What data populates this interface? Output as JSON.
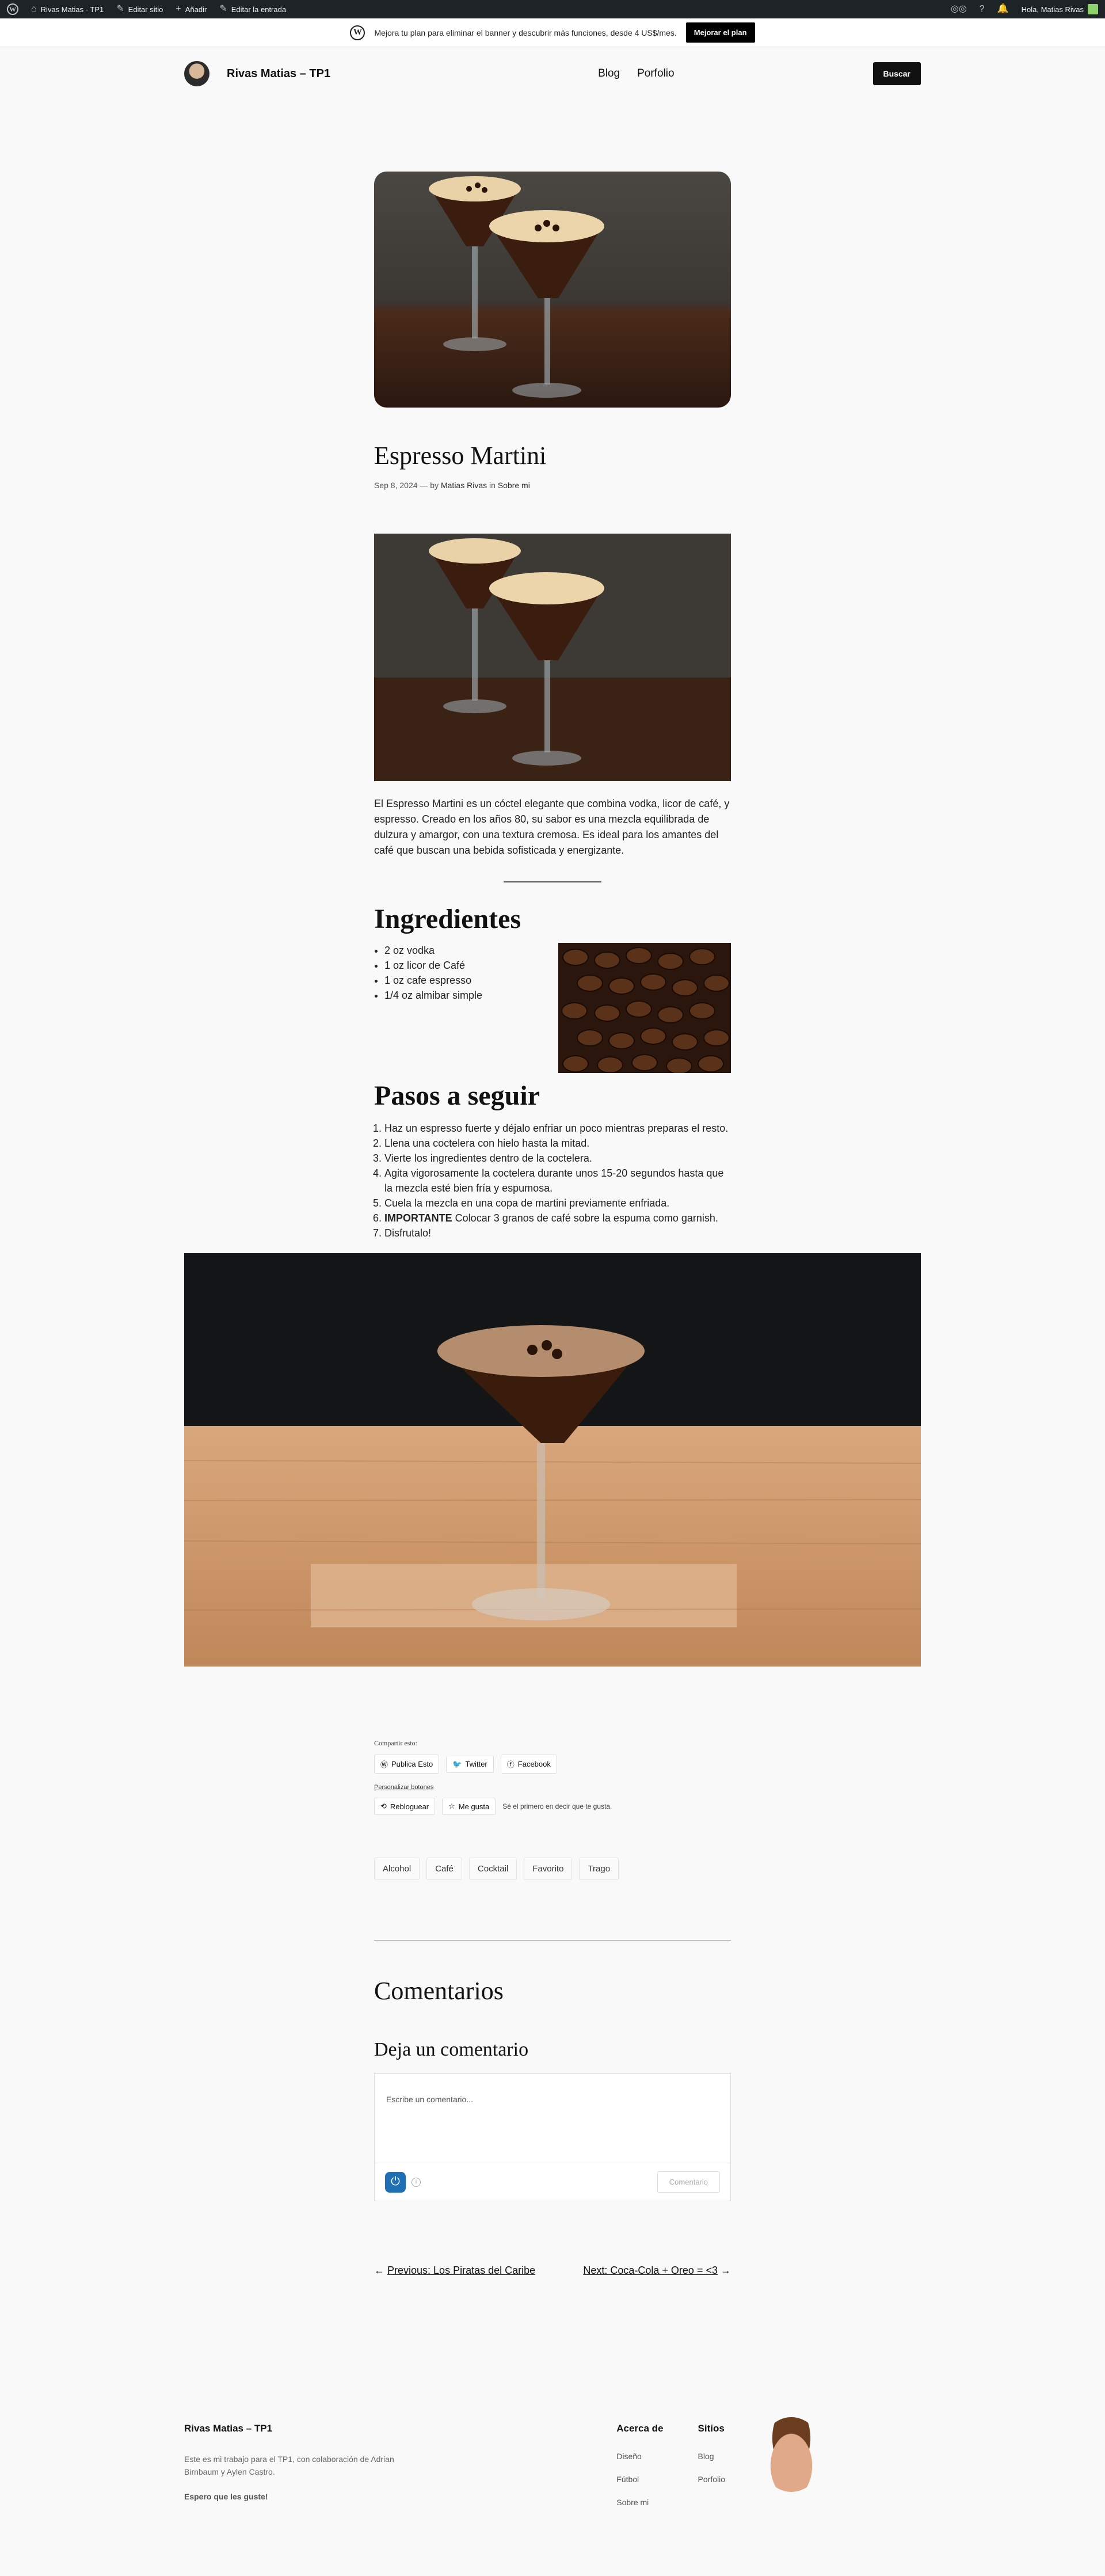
{
  "admin_bar": {
    "site_name": "Rivas Matias - TP1",
    "edit_site": "Editar sitio",
    "add": "Añadir",
    "edit_post": "Editar la entrada",
    "greeting": "Hola, Matias Rivas"
  },
  "banner": {
    "text": "Mejora tu plan para eliminar el banner y descubrir más funciones, desde 4 US$/mes.",
    "button": "Mejorar el plan"
  },
  "header": {
    "site_title": "Rivas Matias – TP1",
    "nav": [
      "Blog",
      "Porfolio"
    ],
    "search_button": "Buscar"
  },
  "post": {
    "title": "Espresso Martini",
    "date": "Sep 8, 2024",
    "by": "— by",
    "author": "Matias Rivas",
    "in": "in",
    "category": "Sobre mi",
    "intro": "El Espresso Martini es un cóctel elegante que combina vodka, licor de café, y espresso. Creado en los años 80, su sabor es una mezcla equilibrada de dulzura y amargor, con una textura cremosa. Es ideal para los amantes del café que buscan una bebida sofisticada y energizante.",
    "ingredients_heading": "Ingredientes",
    "ingredients": [
      "2 oz vodka",
      "1 oz licor de Café",
      "1 oz cafe espresso",
      "1/4 oz almibar simple"
    ],
    "steps_heading": "Pasos a seguir",
    "steps": [
      "Haz un espresso fuerte y déjalo enfriar un poco mientras preparas el resto.",
      "Llena una coctelera con hielo hasta la mitad.",
      "Vierte los ingredientes dentro de la coctelera.",
      "Agita vigorosamente la coctelera durante unos 15-20 segundos hasta que la mezcla esté bien fría y espumosa.",
      "Cuela la mezcla en una copa de martini previamente enfriada."
    ],
    "step6_strong": "IMPORTANTE",
    "step6_rest": " Colocar 3 granos de café sobre la espuma como garnish.",
    "step7": "Disfrutalo!"
  },
  "share": {
    "label": "Compartir esto:",
    "buttons": [
      "Publica Esto",
      "Twitter",
      "Facebook"
    ],
    "customize": "Personalizar botones",
    "reblog": "Rebloguear",
    "like": "Me gusta",
    "like_note": "Sé el primero en decir que te gusta."
  },
  "tags": [
    "Alcohol",
    "Café",
    "Cocktail",
    "Favorito",
    "Trago"
  ],
  "comments": {
    "heading": "Comentarios",
    "leave": "Deja un comentario",
    "placeholder": "Escribe un comentario...",
    "submit": "Comentario"
  },
  "post_nav": {
    "prev": "Previous: Los Piratas del Caribe",
    "next": "Next: Coca-Cola + Oreo = <3"
  },
  "footer": {
    "title": "Rivas Matias – TP1",
    "desc": "Este es mi trabajo para el TP1, con colaboración de Adrian Birnbaum y Aylen Castro.",
    "bold": "Espero que les guste!",
    "col1_head": "Acerca de",
    "col1_links": [
      "Diseño",
      "Fútbol",
      "Sobre mi"
    ],
    "col2_head": "Sitios",
    "col2_links": [
      "Blog",
      "Porfolio"
    ]
  }
}
